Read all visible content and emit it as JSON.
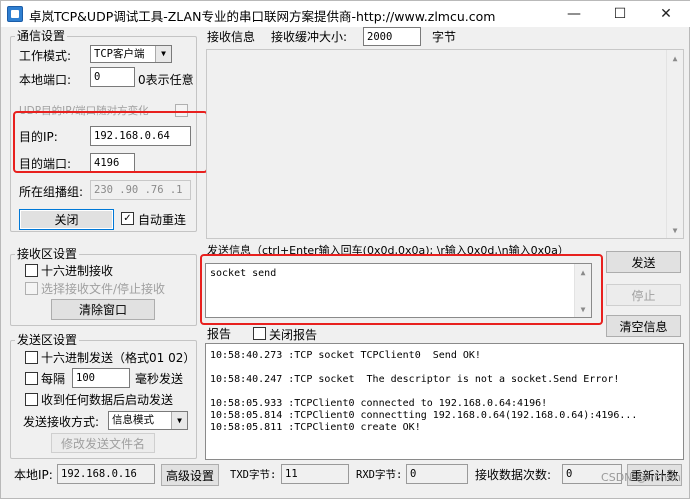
{
  "window": {
    "title": "卓岚TCP&UDP调试工具-ZLAN专业的串口联网方案提供商-http://www.zlmcu.com",
    "minimize": "—",
    "maximize": "☐",
    "close": "✕"
  },
  "comm": {
    "group_label": "通信设置",
    "mode_label": "工作模式:",
    "mode_value": "TCP客户端",
    "local_port_label": "本地端口:",
    "local_port_value": "0",
    "local_port_hint": "0表示任意",
    "udp_follow_label": "UDP目的IP/端口随对方变化",
    "dest_ip_label": "目的IP:",
    "dest_ip_value": "192.168.0.64",
    "dest_port_label": "目的端口:",
    "dest_port_value": "4196",
    "multicast_label": "所在组播组:",
    "multicast_value": "230 .90 .76 .1",
    "close_button": "关闭",
    "auto_reconnect_label": "自动重连",
    "auto_reconnect_checked": "✓"
  },
  "recv_settings": {
    "group_label": "接收区设置",
    "hex_recv": "十六进制接收",
    "select_stop": "选择接收文件/停止接收",
    "clear_window": "清除窗口"
  },
  "send_settings": {
    "group_label": "发送区设置",
    "hex_send": "十六进制发送（格式01 02）",
    "every_label": "每隔",
    "every_value": "100",
    "ms_send": "毫秒发送",
    "recv_trigger": "收到任何数据后启动发送",
    "mode_label": "发送接收方式:",
    "mode_value": "信息模式",
    "modify_file": "修改发送文件名"
  },
  "receive": {
    "title": "接收信息",
    "buffer_label": "接收缓冲大小:",
    "buffer_value": "2000",
    "unit": "字节"
  },
  "send": {
    "title": "发送信息（ctrl+Enter输入回车(0x0d,0x0a); \\r输入0x0d,\\n输入0x0a）",
    "content": "socket send",
    "send_button": "发送",
    "stop_button": "停止",
    "clear_info_button": "清空信息"
  },
  "report": {
    "title": "报告",
    "close_report": "关闭报告",
    "lines": [
      "10:58:40.273 :TCP socket TCPClient0  Send OK!",
      "",
      "10:58:40.247 :TCP socket  The descriptor is not a socket.Send Error!",
      "",
      "10:58:05.933 :TCPClient0 connected to 192.168.0.64:4196!",
      "10:58:05.814 :TCPClient0 connectting 192.168.0.64(192.168.0.64):4196...",
      "10:58:05.811 :TCPClient0 create OK!"
    ]
  },
  "status": {
    "local_ip_label": "本地IP:",
    "local_ip_value": "192.168.0.16",
    "advanced": "高级设置",
    "txd_label": "TXD字节:",
    "txd_value": "11",
    "rxd_label": "RXD字节:",
    "rxd_value": "0",
    "recv_count_label": "接收数据次数:",
    "recv_count_value": "0",
    "recount": "重新计数"
  },
  "watermark": "CSDN @lrchen",
  "colors": {
    "highlight": "#e8201e",
    "focus": "#0078d7"
  }
}
